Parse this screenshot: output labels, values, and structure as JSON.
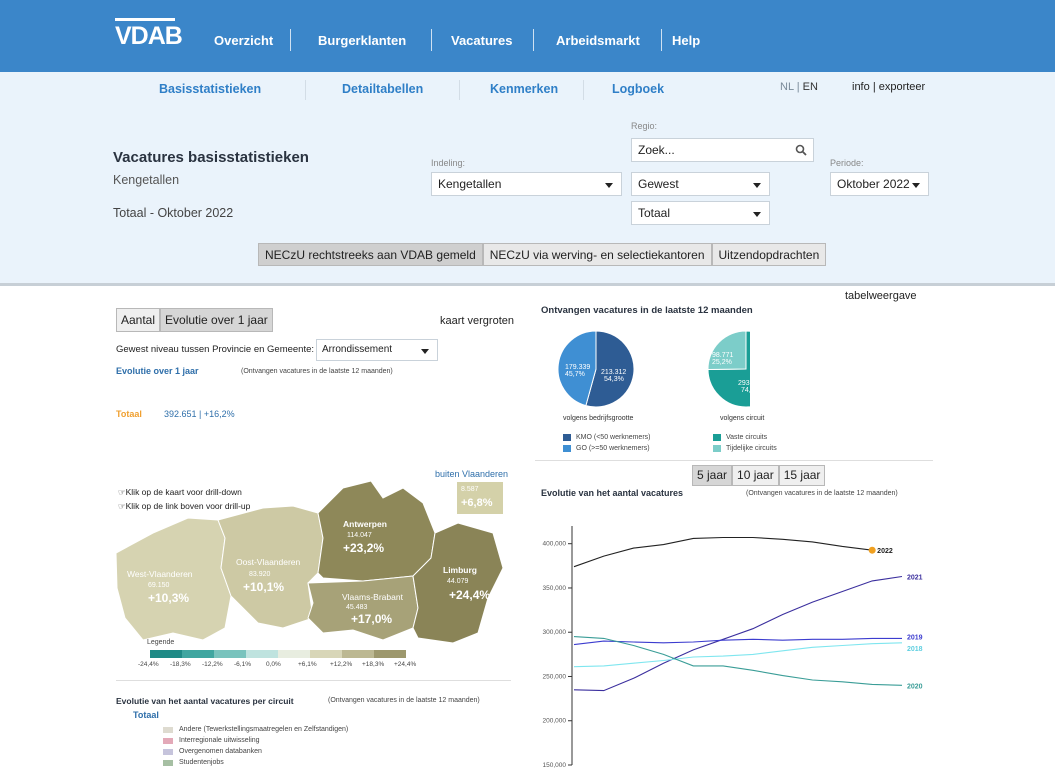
{
  "nav": {
    "logo": "VDAB",
    "items": [
      "Overzicht",
      "Burgerklanten",
      "Vacatures",
      "Arbeidsmarkt",
      "Help"
    ]
  },
  "subnav": {
    "items": [
      "Basisstatistieken",
      "Detailtabellen",
      "Kenmerken",
      "Logboek"
    ],
    "lang_nl": "NL",
    "lang_sep": "|",
    "lang_en": "EN",
    "info": "info",
    "info_sep": "|",
    "exporteer": "exporteer"
  },
  "header": {
    "title": "Vacatures basisstatistieken",
    "subtitle": "Kengetallen",
    "total": "Totaal - Oktober 2022"
  },
  "filters": {
    "indeling_label": "Indeling:",
    "indeling_value": "Kengetallen",
    "regio_label": "Regio:",
    "search_placeholder": "Zoek...",
    "gewest_value": "Gewest",
    "totaal_value": "Totaal",
    "periode_label": "Periode:",
    "periode_value": "Oktober 2022"
  },
  "source_buttons": [
    "NECzU rechtstreeks aan VDAB gemeld",
    "NECzU via werving- en selectiekantoren",
    "Uitzendopdrachten"
  ],
  "left": {
    "tabs": [
      "Aantal",
      "Evolutie over 1 jaar"
    ],
    "kaart_link": "kaart vergroten",
    "gewest_label": "Gewest niveau tussen Provincie en Gemeente:",
    "gewest_select": "Arrondissement",
    "evol_title": "Evolutie over 1 jaar",
    "evol_note": "(Ontvangen vacatures in de laatste 12 maanden)",
    "totaal_label": "Totaal",
    "totaal_value": "392.651 | +16,2%",
    "buiten_label": "buiten Vlaanderen",
    "buiten_n": "8.587",
    "buiten_pct": "+6,8%",
    "drill_down": "Klik op de kaart voor drill-down",
    "drill_up": "Klik op de link boven voor drill-up",
    "provinces": [
      {
        "name": "West-Vlaanderen",
        "n": "69.150",
        "pct": "+10,3%",
        "color": "#d6d3b1"
      },
      {
        "name": "Oost-Vlaanderen",
        "n": "83.920",
        "pct": "+10,1%",
        "color": "#cdc9a4"
      },
      {
        "name": "Antwerpen",
        "n": "114.047",
        "pct": "+23,2%",
        "color": "#8e8859"
      },
      {
        "name": "Vlaams-Brabant",
        "n": "45.483",
        "pct": "+17,0%",
        "color": "#a7a278"
      },
      {
        "name": "Limburg",
        "n": "44.079",
        "pct": "+24,4%",
        "color": "#8a8457"
      }
    ],
    "legend_title": "Legende",
    "legend_ticks": [
      "-24,4%",
      "-18,3%",
      "-12,2%",
      "-6,1%",
      "0,0%",
      "+6,1%",
      "+12,2%",
      "+18,3%",
      "+24,4%"
    ],
    "legend_colors": [
      "#1f8a86",
      "#40a6a0",
      "#79c3bd",
      "#bfe3df",
      "#e8ede0",
      "#d8d6b8",
      "#bcb892",
      "#9d986d",
      "#7f7a4f"
    ],
    "circuit_title": "Evolutie van het aantal vacatures per circuit",
    "circuit_note": "(Ontvangen vacatures in de laatste 12 maanden)",
    "circuit_totaal": "Totaal",
    "circuit_legend": [
      {
        "label": "Andere (Tewerkstellingsmaatregelen en Zelfstandigen)",
        "color": "#dedbd0"
      },
      {
        "label": "Interregionale uitwisseling",
        "color": "#e3a9b8"
      },
      {
        "label": "Overgenomen databanken",
        "color": "#c6c4dc"
      },
      {
        "label": "Studentenjobs",
        "color": "#a6bfa3"
      }
    ]
  },
  "right": {
    "tabelweergave": "tabelweergave",
    "pies_title": "Ontvangen vacatures in de laatste 12 maanden",
    "pie1": {
      "caption": "volgens bedrijfsgrootte",
      "slices": [
        {
          "label": "KMO (<50 werknemers)",
          "n": "213.312",
          "pct": "54,3%",
          "value": 54.3,
          "color": "#2e5c94"
        },
        {
          "label": "GO (>=50 werknemers)",
          "n": "179.339",
          "pct": "45,7%",
          "value": 45.7,
          "color": "#3f8fd3"
        }
      ]
    },
    "pie2": {
      "caption": "volgens circuit",
      "slices": [
        {
          "label": "Vaste circuits",
          "n": "293.880",
          "pct": "74,8%",
          "value": 74.8,
          "color": "#1a9e96"
        },
        {
          "label": "Tijdelijke circuits",
          "n": "98.771",
          "pct": "25,2%",
          "value": 25.2,
          "color": "#7ccdc9"
        }
      ]
    },
    "year_tabs": [
      "5 jaar",
      "10 jaar",
      "15 jaar"
    ],
    "evo_title": "Evolutie van het aantal vacatures",
    "evo_note": "(Ontvangen vacatures in de laatste 12 maanden)"
  },
  "chart_data": {
    "type": "line",
    "title": "Evolutie van het aantal vacatures",
    "ylim": [
      150000,
      420000
    ],
    "yticks": [
      "150,000",
      "200,000",
      "250,000",
      "300,000",
      "350,000",
      "400,000"
    ],
    "ytick_values": [
      150000,
      200000,
      250000,
      300000,
      350000,
      400000
    ],
    "x": [
      1,
      2,
      3,
      4,
      5,
      6,
      7,
      8,
      9,
      10,
      11,
      12
    ],
    "series": [
      {
        "name": "2022",
        "color": "#222222",
        "values": [
          374000,
          386000,
          395000,
          399000,
          406000,
          407000,
          407000,
          405000,
          402000,
          397000,
          392651,
          null
        ]
      },
      {
        "name": "2021",
        "color": "#3b2f9e",
        "values": [
          235000,
          234000,
          248000,
          265000,
          280000,
          292000,
          304000,
          320000,
          334000,
          346000,
          358000,
          363000
        ]
      },
      {
        "name": "2019",
        "color": "#3c3ccf",
        "values": [
          286000,
          290000,
          289000,
          288000,
          289000,
          291000,
          292000,
          291000,
          292000,
          292000,
          293000,
          293000
        ]
      },
      {
        "name": "2018",
        "color": "#7fe6ef",
        "values": [
          261000,
          262000,
          265000,
          268000,
          272000,
          273000,
          275000,
          279000,
          283000,
          285000,
          287000,
          288000
        ]
      },
      {
        "name": "2020",
        "color": "#3a9d97",
        "values": [
          295000,
          293000,
          285000,
          275000,
          262000,
          262000,
          257000,
          251000,
          246000,
          244000,
          241000,
          240000
        ]
      }
    ]
  }
}
